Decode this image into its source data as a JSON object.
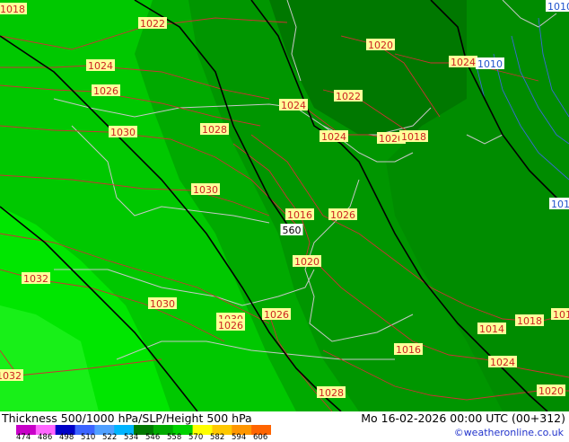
{
  "footer": {
    "title": "Thickness 500/1000 hPa/SLP/Height 500 hPa",
    "run_info": "Mo 16-02-2026 00:00 UTC (00+312)",
    "credit": "©weatheronline.co.uk"
  },
  "colorbar": {
    "ticks": [
      "474",
      "486",
      "498",
      "510",
      "522",
      "534",
      "546",
      "558",
      "570",
      "582",
      "594",
      "606"
    ],
    "colors": [
      "#c800c8",
      "#ff66ff",
      "#0000c8",
      "#3c64ff",
      "#50a0ff",
      "#00b4ff",
      "#007800",
      "#00aa00",
      "#00d200",
      "#ffff00",
      "#ffc800",
      "#ff9600",
      "#ff6400"
    ]
  },
  "map": {
    "fill_colors": {
      "bright": "#00e600",
      "mid": "#00c800",
      "dark": "#00a000",
      "darker": "#008c00",
      "darkest": "#007800"
    },
    "isobar_color": "#cc3333",
    "low_isobar_color": "#2060d0",
    "height_contour_color": "#000000",
    "coast_color": "#c8c8c8",
    "isobar_labels": [
      "1018",
      "1022",
      "1024",
      "1026",
      "1030",
      "1028",
      "1030",
      "1032",
      "1030",
      "1030",
      "1026",
      "1032",
      "1026",
      "1024",
      "1028",
      "1020",
      "1022",
      "1024",
      "1020",
      "1018",
      "1016",
      "1026",
      "1020",
      "1024",
      "1014",
      "1018",
      "1016",
      "1024",
      "1020",
      "1016"
    ],
    "low_labels": [
      "1010",
      "1010",
      "1010"
    ],
    "height_labels": [
      "560"
    ]
  }
}
